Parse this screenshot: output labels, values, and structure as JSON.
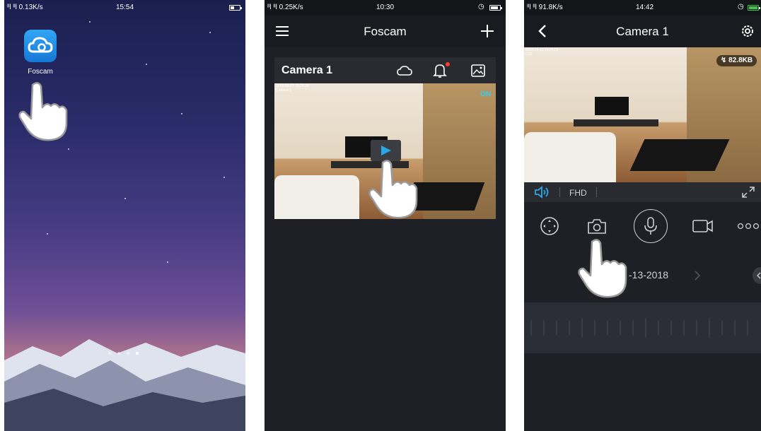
{
  "screens": [
    {
      "id": "home",
      "status": {
        "signal": "ᴵᴵl ᴵᴵl 0.13K/s",
        "time": "15:54"
      },
      "app_icon_label": "Foscam",
      "icons": [
        "cloud-app-icon",
        "hand-pointer-icon"
      ],
      "page_indicator": {
        "count": 4,
        "active": 4
      }
    },
    {
      "id": "device-list",
      "status": {
        "signal": "ᴵᴵl ᴵᴵl 0.25K/s",
        "time": "10:30"
      },
      "header": {
        "title": "Foscam",
        "menu_icon": "menu-icon",
        "add_icon": "plus-icon"
      },
      "camera_card": {
        "name": "Camera 1",
        "timestamp": "2018-06-07 16:25:20",
        "overlay_name": "Camera 1",
        "status": "ON",
        "icons": [
          "cloud-icon",
          "bell-icon",
          "image-icon",
          "play-icon"
        ]
      }
    },
    {
      "id": "live-view",
      "status": {
        "signal": "ᴵᴵl ᴵᴵl 91.8K/s",
        "time": "14:42"
      },
      "header": {
        "title": "Camera 1",
        "back_icon": "chevron-left-icon",
        "settings_icon": "gear-icon"
      },
      "video": {
        "timestamp": "2018-06-13 14:25:23",
        "overlay_name": "C2E",
        "bitrate": "82.8KB"
      },
      "quality": "FHD",
      "tools": [
        "ptz-icon",
        "camera-snapshot-icon",
        "microphone-icon",
        "record-icon",
        "more-icon"
      ],
      "date_fragment": "-13-2018",
      "accent": "#2aa8e6"
    }
  ]
}
